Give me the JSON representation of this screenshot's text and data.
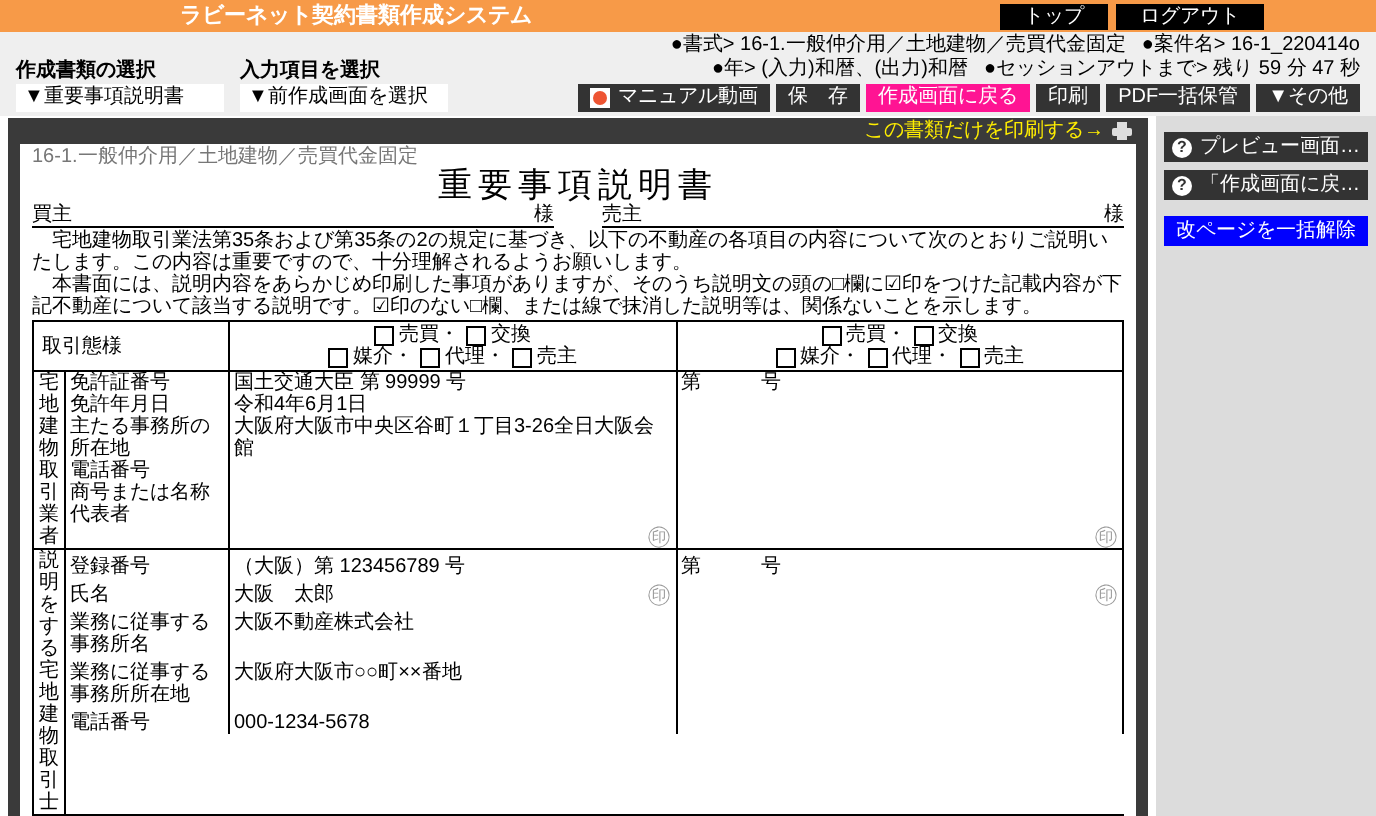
{
  "header": {
    "title": "ラビーネット契約書類作成システム",
    "buttons": [
      "トップ",
      "ログアウト"
    ]
  },
  "toolbar": {
    "selects": [
      {
        "label": "作成書類の選択",
        "value": "▼重要事項説明書"
      },
      {
        "label": "入力項目を選択",
        "value": "▼前作成画面を選択"
      }
    ],
    "info": [
      [
        "●書式> 16-1.一般仲介用／土地建物／売買代金固定",
        "●案件名> 16-1_220414o"
      ],
      [
        "●年> (入力)和暦、(出力)和暦",
        "●セッションアウトまで> 残り 59 分 47 秒"
      ]
    ],
    "buttons": [
      {
        "label": "マニュアル動画",
        "kind": "video"
      },
      {
        "label": "保　存",
        "kind": "dark"
      },
      {
        "label": "作成画面に戻る",
        "kind": "accent"
      },
      {
        "label": "印刷",
        "kind": "dark"
      },
      {
        "label": "PDF一括保管",
        "kind": "dark"
      },
      {
        "label": "▼その他",
        "kind": "dark"
      }
    ]
  },
  "viewer": {
    "print_link": "この書類だけを印刷する→"
  },
  "document": {
    "form_label": "16-1.一般仲介用／土地建物／売買代金固定",
    "title": "重要事項説明書",
    "parties": [
      {
        "label": "買主",
        "suffix": "様"
      },
      {
        "label": "売主",
        "suffix": "様"
      }
    ],
    "intro": [
      "　宅地建物取引業法第35条および第35条の2の規定に基づき、以下の不動産の各項目の内容について次のとおりご説明いたします。この内容は重要ですので、十分理解されるようお願いします。",
      "　本書面には、説明内容をあらかじめ印刷した事項がありますが、そのうち説明文の頭の□欄に☑印をつけた記載内容が下記不動産について該当する説明です。☑印のない□欄、または線で抹消した説明等は、関係ないことを示します。"
    ],
    "transaction": {
      "label": "取引態様",
      "columns": [
        {
          "lines": [
            [
              {
                "label": "売買・",
                "checked": false
              },
              {
                "label": "交換",
                "checked": false
              }
            ],
            [
              {
                "label": "媒介・",
                "checked": false
              },
              {
                "label": "代理・",
                "checked": false
              },
              {
                "label": "売主",
                "checked": false
              }
            ]
          ]
        },
        {
          "lines": [
            [
              {
                "label": "売買・",
                "checked": false
              },
              {
                "label": "交換",
                "checked": false
              }
            ],
            [
              {
                "label": "媒介・",
                "checked": false
              },
              {
                "label": "代理・",
                "checked": false
              },
              {
                "label": "売主",
                "checked": false
              }
            ]
          ]
        }
      ]
    },
    "licensee": {
      "group": "宅地建物取引業者",
      "fields": [
        "免許証番号",
        "免許年月日",
        "主たる事務所の所在地",
        "電話番号",
        "商号または名称",
        "代表者"
      ],
      "columns": [
        {
          "values": [
            "国土交通大臣 第 99999 号",
            "令和4年6月1日",
            "大阪府大阪市中央区谷町１丁目3-26全日大阪会館"
          ],
          "seal": "㊞"
        },
        {
          "values": [
            "第　　　号"
          ],
          "seal": "㊞"
        }
      ]
    },
    "agent": {
      "group": "説明をする宅地建物取引士",
      "rows": [
        {
          "label": "登録番号",
          "values": [
            "（大阪）第 123456789 号",
            "第　　　号"
          ]
        },
        {
          "label": "氏名",
          "values": [
            "大阪　太郎"
          ]
        },
        {
          "label": "業務に従事する事務所名",
          "values": [
            "大阪不動産株式会社"
          ]
        },
        {
          "label": "業務に従事する事務所所在地",
          "values": [
            "大阪府大阪市○○町××番地"
          ]
        },
        {
          "label": "電話番号",
          "values": [
            "000-1234-5678"
          ]
        }
      ],
      "seals": [
        "㊞",
        "㊞"
      ]
    }
  },
  "side_panel": {
    "buttons": [
      {
        "label": "プレビュー画面…",
        "kind": "help",
        "icon": "?"
      },
      {
        "label": "「作成画面に戻…",
        "kind": "help",
        "icon": "?"
      },
      {
        "label": "改ページを一括解除",
        "kind": "primary"
      }
    ]
  }
}
